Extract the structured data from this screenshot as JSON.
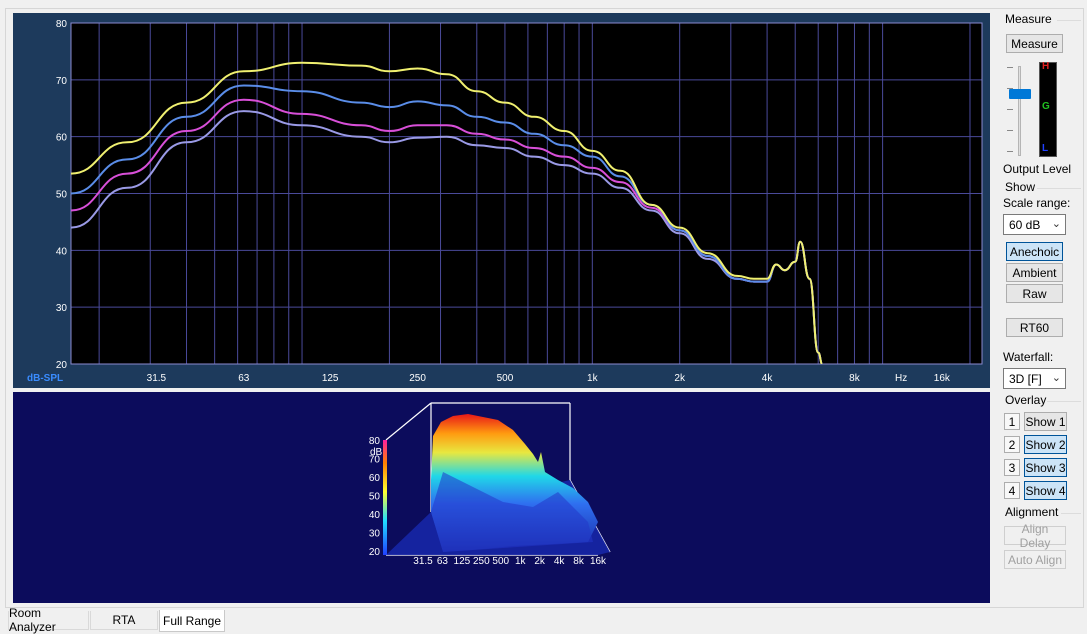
{
  "chart": {
    "y_unit_label": "dB-SPL",
    "x_unit_label": "Hz",
    "chart_data": {
      "type": "line",
      "title": "",
      "xlabel": "Hz",
      "ylabel": "dB-SPL",
      "x_scale": "log",
      "xlim": [
        16,
        22000
      ],
      "ylim": [
        20,
        80
      ],
      "y_ticks": [
        "80",
        "70",
        "60",
        "50",
        "40",
        "30",
        "20"
      ],
      "x_ticks": [
        "31.5",
        "63",
        "125",
        "250",
        "500",
        "1k",
        "2k",
        "4k",
        "8k",
        "16k"
      ],
      "grid": true,
      "series": [
        {
          "color": "#f0f070",
          "x": [
            16,
            25,
            40,
            63,
            100,
            160,
            200,
            250,
            315,
            400,
            500,
            630,
            800,
            1000,
            1250,
            1600,
            2000,
            2500,
            3150,
            3600,
            4000,
            4300,
            4600,
            5000,
            5200,
            5600,
            6000,
            6200
          ],
          "y": [
            53.5,
            59,
            66,
            71.5,
            73,
            72.5,
            71.5,
            72,
            71,
            68,
            66,
            63.5,
            61,
            57.5,
            54,
            48,
            44,
            39.5,
            35.5,
            35,
            35,
            37.5,
            36.5,
            38,
            41.5,
            35,
            22,
            20
          ]
        },
        {
          "color": "#5a8de8",
          "x": [
            16,
            25,
            40,
            63,
            100,
            160,
            200,
            250,
            315,
            400,
            500,
            630,
            800,
            1000,
            1250,
            1600,
            2000,
            2500,
            3150,
            3600,
            4000,
            4300,
            4600,
            5000,
            5200,
            5600,
            6000,
            6200
          ],
          "y": [
            50,
            56,
            63.5,
            69,
            68,
            66,
            65.2,
            66.2,
            65.5,
            63.5,
            62.5,
            60.5,
            58.5,
            56.5,
            53,
            48,
            43.5,
            39,
            35,
            34.5,
            34.5,
            37.5,
            36.5,
            38,
            41.5,
            35,
            22,
            20
          ]
        },
        {
          "color": "#d84fd8",
          "x": [
            16,
            25,
            40,
            63,
            100,
            160,
            200,
            250,
            315,
            400,
            500,
            630,
            800,
            1000,
            1250,
            1600,
            2000,
            2500,
            3150,
            3600,
            4000,
            4300,
            4600,
            5000,
            5200,
            5600,
            6000,
            6200
          ],
          "y": [
            47,
            53.5,
            61,
            66.5,
            64,
            62,
            61,
            62,
            62,
            60.5,
            59.5,
            58,
            56.5,
            54.5,
            52,
            47.5,
            43.5,
            39,
            35,
            34.5,
            34.5,
            37.5,
            36.5,
            38,
            41.5,
            35,
            22,
            20
          ]
        },
        {
          "color": "#9a9ae6",
          "x": [
            16,
            25,
            40,
            63,
            100,
            160,
            200,
            250,
            315,
            400,
            500,
            630,
            800,
            1000,
            1250,
            1600,
            2000,
            2500,
            3150,
            3600,
            4000,
            4300,
            4600,
            5000,
            5200,
            5600,
            6000,
            6200
          ],
          "y": [
            44,
            51,
            59,
            64.5,
            62,
            60,
            59,
            59.8,
            60,
            58.5,
            58,
            56.5,
            55,
            53.5,
            51,
            47,
            43,
            38.5,
            35,
            34.5,
            34.5,
            37.5,
            36.5,
            38,
            41.5,
            35,
            22,
            20
          ]
        }
      ]
    }
  },
  "waterfall": {
    "z_axis_label": "dB",
    "z_ticks": [
      "80",
      "70",
      "60",
      "50",
      "40",
      "30",
      "20"
    ],
    "x_ticks": [
      "31.5",
      "63",
      "125",
      "250",
      "500",
      "1k",
      "2k",
      "4k",
      "8k",
      "16k"
    ]
  },
  "sidebar": {
    "measure_group": "Measure",
    "measure_button": "Measure",
    "output_level_label": "Output Level",
    "meter_labels": [
      "H",
      "G",
      "L"
    ],
    "show_group": "Show",
    "scale_range_label": "Scale range:",
    "scale_range_value": "60 dB",
    "anechoic_button": "Anechoic",
    "ambient_button": "Ambient",
    "raw_button": "Raw",
    "rt60_button": "RT60",
    "waterfall_label": "Waterfall:",
    "waterfall_value": "3D [F]",
    "overlay_group": "Overlay",
    "overlays": [
      {
        "num": "1",
        "label": "Show 1",
        "active": false
      },
      {
        "num": "2",
        "label": "Show 2",
        "active": true
      },
      {
        "num": "3",
        "label": "Show 3",
        "active": true
      },
      {
        "num": "4",
        "label": "Show 4",
        "active": true
      }
    ],
    "alignment_group": "Alignment",
    "align_delay_button": "Align Delay",
    "auto_align_button": "Auto Align"
  },
  "tabs": [
    {
      "label": "Room Analyzer",
      "active": false
    },
    {
      "label": "RTA",
      "active": false
    },
    {
      "label": "Full Range",
      "active": true
    }
  ]
}
